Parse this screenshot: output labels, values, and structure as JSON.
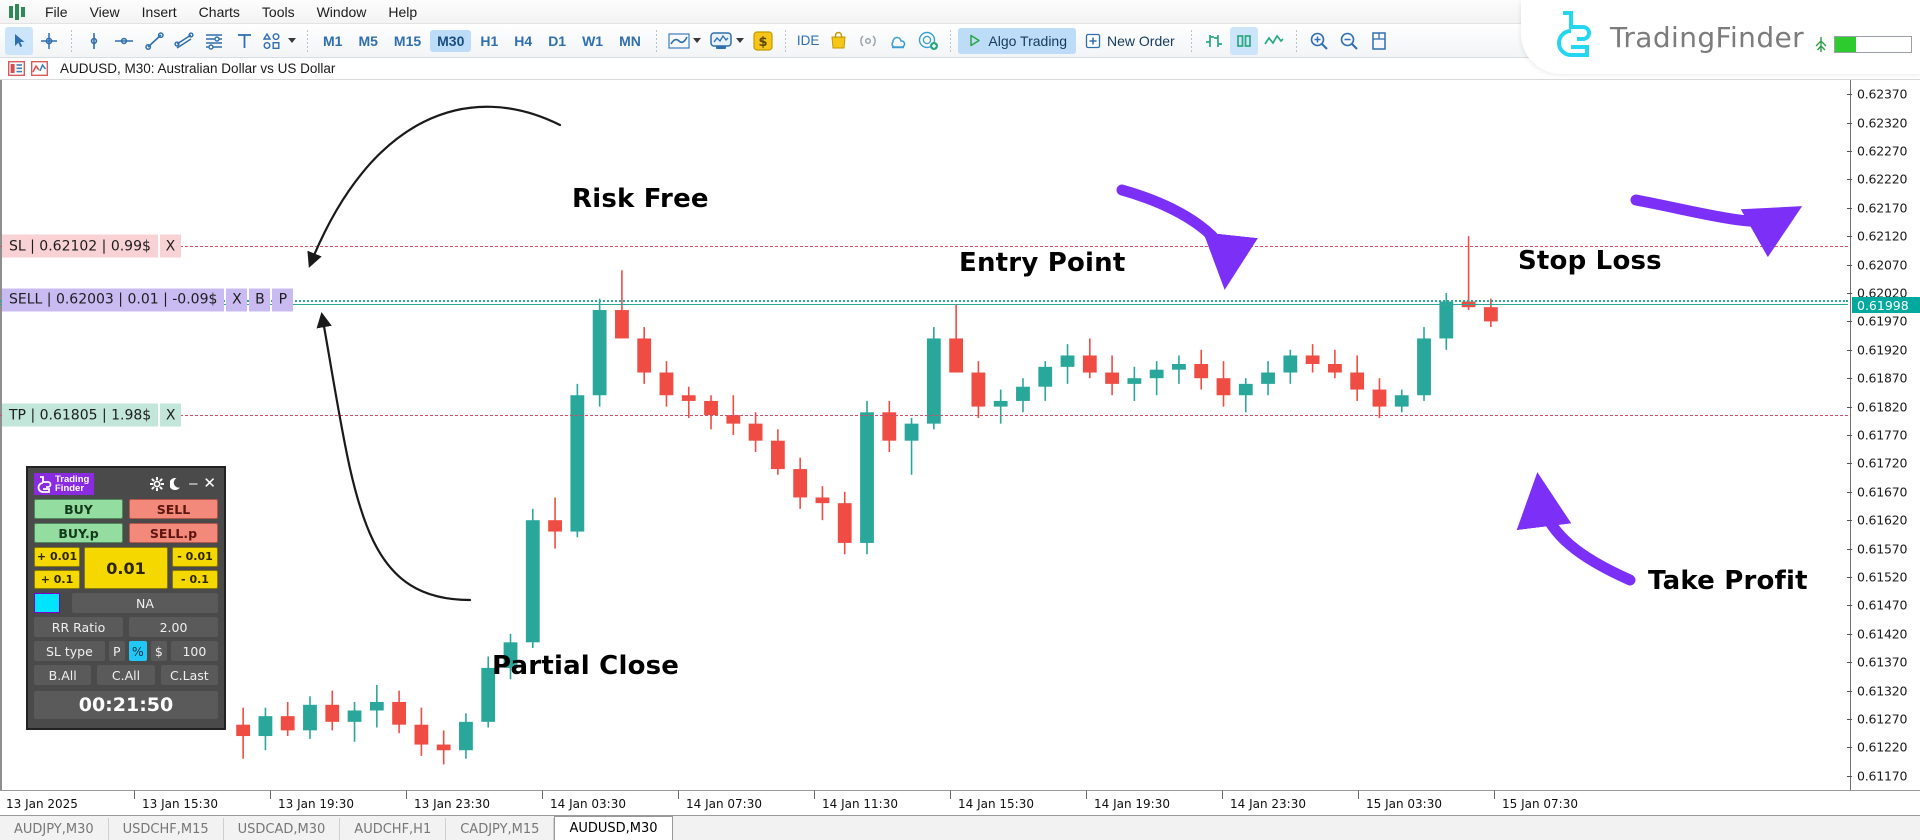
{
  "window": {
    "minimize": "–",
    "maximize": "❐",
    "close": "✕"
  },
  "menu": {
    "items": [
      "File",
      "View",
      "Insert",
      "Charts",
      "Tools",
      "Window",
      "Help"
    ]
  },
  "toolbar": {
    "tools": [
      {
        "name": "cursor-tool",
        "icon": "cursor-icon",
        "active": true
      },
      {
        "name": "crosshair-tool",
        "icon": "crosshair-icon",
        "active": false
      },
      {
        "name": "vertical-line-tool",
        "icon": "vertical-line-icon",
        "active": false
      },
      {
        "name": "horizontal-line-tool",
        "icon": "horizontal-line-icon",
        "active": false
      },
      {
        "name": "trendline-tool",
        "icon": "trendline-icon",
        "active": false
      },
      {
        "name": "channel-tool",
        "icon": "channel-icon",
        "active": false
      },
      {
        "name": "fibonacci-tool",
        "icon": "fibonacci-icon",
        "active": false
      },
      {
        "name": "text-tool",
        "icon": "text-icon",
        "active": false
      },
      {
        "name": "shapes-tool",
        "icon": "shapes-icon",
        "active": false
      }
    ],
    "timeframes": [
      "M1",
      "M5",
      "M15",
      "M30",
      "H1",
      "H4",
      "D1",
      "W1",
      "MN"
    ],
    "active_timeframe": "M30",
    "chart_types": [
      "line-chart-icon",
      "bar-chart-icon",
      "dollar-icon"
    ],
    "utilities": [
      "IDE",
      "market-bag-icon",
      "signals-icon",
      "cloud-icon",
      "vps-icon"
    ],
    "algo_trading_label": "Algo Trading",
    "algo_trading_icon": "play-icon",
    "new_order_label": "New Order",
    "new_order_icon": "plus-square-icon",
    "view_tools": [
      "bar-chart-icon-2",
      "candles-icon",
      "line-icon"
    ],
    "active_view": "candles-icon",
    "zoom_in_icon": "zoom-in-icon",
    "zoom_out_icon": "zoom-out-icon",
    "data_window_icon": "data-window-icon"
  },
  "brand": {
    "name": "TradingFinder",
    "logo_icon": "tradingfinder-logo-icon",
    "account_icon": "account-health-icon",
    "meter_percent": 28
  },
  "chart_header": {
    "properties_icon": "chart-properties-icon",
    "indicators_icon": "indicators-icon",
    "title": "AUDUSD, M30:  Australian Dollar vs US Dollar"
  },
  "colors": {
    "bull": "#2aa79b",
    "bear": "#ef4d44",
    "sl_line": "#d4536b",
    "tp_line": "#cc4f6a",
    "entry_line": "#2fa79b",
    "current_price_bg": "#00a99d",
    "annotation_arrow_purple": "#7b2ff7",
    "annotation_arrow_black": "#1a1a1a",
    "panel_bg": "#4a4a4a"
  },
  "orders": {
    "stop_loss": {
      "label": "SL | 0.62102 | 0.99$",
      "price": 0.62102,
      "amount": "0.99$",
      "close_button": "X"
    },
    "entry": {
      "label": "SELL | 0.62003 | 0.01 | -0.09$",
      "price": 0.62003,
      "volume": "0.01",
      "profit": "-0.09$",
      "buttons": [
        "X",
        "B",
        "P"
      ]
    },
    "take_profit": {
      "label": "TP | 0.61805 | 1.98$",
      "price": 0.61805,
      "amount": "1.98$",
      "close_button": "X"
    }
  },
  "annotations": [
    {
      "id": "risk-free",
      "text": "Risk Free"
    },
    {
      "id": "entry-point",
      "text": "Entry Point"
    },
    {
      "id": "stop-loss",
      "text": "Stop Loss"
    },
    {
      "id": "take-profit",
      "text": "Take Profit"
    },
    {
      "id": "partial-close",
      "text": "Partial Close"
    }
  ],
  "panel": {
    "logo_text_1": "Trading",
    "logo_text_2": "Finder",
    "logo_icon": "tradingfinder-mini-logo-icon",
    "settings_icon": "gear-icon",
    "theme_icon": "moon-icon",
    "minimize_icon": "minimize-icon",
    "close_icon": "close-icon",
    "buy": "BUY",
    "sell": "SELL",
    "buy_pending": "BUY.p",
    "sell_pending": "SELL.p",
    "lot_plus_small": "+ 0.01",
    "lot_plus_big": "+ 0.1",
    "lot_minus_small": "- 0.01",
    "lot_minus_big": "- 0.1",
    "lot_value": "0.01",
    "color_swatch": "#00e5ff",
    "na_label": "NA",
    "rr_label": "RR Ratio",
    "rr_value": "2.00",
    "sl_type_label": "SL type",
    "sl_type_options": [
      "P",
      "%",
      "$"
    ],
    "sl_type_active": "%",
    "sl_type_value": "100",
    "close_all_buy": "B.All",
    "close_all": "C.All",
    "close_last": "C.Last",
    "timer": "00:21:50"
  },
  "tabs": {
    "items": [
      "AUDJPY,M30",
      "USDCHF,M15",
      "USDCAD,M30",
      "AUDCHF,H1",
      "CADJPY,M15",
      "AUDUSD,M30"
    ],
    "active": "AUDUSD,M30"
  },
  "chart_data": {
    "type": "candlestick",
    "title": "AUDUSD, M30:  Australian Dollar vs US Dollar",
    "symbol": "AUDUSD",
    "timeframe": "M30",
    "ylabel": "",
    "xlabel": "",
    "ylim": [
      0.61145,
      0.62395
    ],
    "grid": false,
    "current_price": "0.61998",
    "price_ticks": [
      "0.62370",
      "0.62320",
      "0.62270",
      "0.62220",
      "0.62170",
      "0.62120",
      "0.62070",
      "0.62020",
      "0.61970",
      "0.61920",
      "0.61870",
      "0.61820",
      "0.61770",
      "0.61720",
      "0.61670",
      "0.61620",
      "0.61570",
      "0.61520",
      "0.61470",
      "0.61420",
      "0.61370",
      "0.61320",
      "0.61270",
      "0.61220",
      "0.61170"
    ],
    "time_ticks": [
      "13 Jan 2025",
      "13 Jan 15:30",
      "13 Jan 19:30",
      "13 Jan 23:30",
      "14 Jan 03:30",
      "14 Jan 07:30",
      "14 Jan 11:30",
      "14 Jan 15:30",
      "14 Jan 19:30",
      "14 Jan 23:30",
      "15 Jan 03:30",
      "15 Jan 07:30"
    ],
    "levels": [
      {
        "name": "stop_loss",
        "value": 0.62102,
        "color": "#d4536b",
        "style": "dashdot"
      },
      {
        "name": "entry",
        "value": 0.62003,
        "color": "#2fa79b",
        "style": "dotted"
      },
      {
        "name": "take_profit",
        "value": 0.61805,
        "color": "#cc4f6a",
        "style": "dashdot"
      }
    ],
    "candles": [
      {
        "o": 0.6126,
        "h": 0.6129,
        "l": 0.612,
        "c": 0.6124
      },
      {
        "o": 0.6124,
        "h": 0.6129,
        "l": 0.61215,
        "c": 0.61275
      },
      {
        "o": 0.61275,
        "h": 0.613,
        "l": 0.6124,
        "c": 0.6125
      },
      {
        "o": 0.6125,
        "h": 0.6131,
        "l": 0.61235,
        "c": 0.61295
      },
      {
        "o": 0.61295,
        "h": 0.6132,
        "l": 0.6125,
        "c": 0.61265
      },
      {
        "o": 0.61265,
        "h": 0.613,
        "l": 0.6123,
        "c": 0.61285
      },
      {
        "o": 0.61285,
        "h": 0.6133,
        "l": 0.61255,
        "c": 0.613
      },
      {
        "o": 0.613,
        "h": 0.6132,
        "l": 0.61245,
        "c": 0.6126
      },
      {
        "o": 0.6126,
        "h": 0.6129,
        "l": 0.61205,
        "c": 0.61225
      },
      {
        "o": 0.61225,
        "h": 0.6125,
        "l": 0.6119,
        "c": 0.61215
      },
      {
        "o": 0.61215,
        "h": 0.6128,
        "l": 0.612,
        "c": 0.61265
      },
      {
        "o": 0.61265,
        "h": 0.6138,
        "l": 0.61255,
        "c": 0.6136
      },
      {
        "o": 0.6136,
        "h": 0.6142,
        "l": 0.6134,
        "c": 0.61405
      },
      {
        "o": 0.61405,
        "h": 0.6164,
        "l": 0.61395,
        "c": 0.6162
      },
      {
        "o": 0.6162,
        "h": 0.6166,
        "l": 0.6157,
        "c": 0.616
      },
      {
        "o": 0.616,
        "h": 0.6186,
        "l": 0.6159,
        "c": 0.6184
      },
      {
        "o": 0.6184,
        "h": 0.6201,
        "l": 0.6182,
        "c": 0.6199
      },
      {
        "o": 0.6199,
        "h": 0.6206,
        "l": 0.6196,
        "c": 0.6194
      },
      {
        "o": 0.6194,
        "h": 0.6196,
        "l": 0.6186,
        "c": 0.6188
      },
      {
        "o": 0.6188,
        "h": 0.619,
        "l": 0.6182,
        "c": 0.6184
      },
      {
        "o": 0.6184,
        "h": 0.61855,
        "l": 0.618,
        "c": 0.6183
      },
      {
        "o": 0.6183,
        "h": 0.6184,
        "l": 0.6178,
        "c": 0.61805
      },
      {
        "o": 0.61805,
        "h": 0.6184,
        "l": 0.6177,
        "c": 0.6179
      },
      {
        "o": 0.6179,
        "h": 0.6181,
        "l": 0.6174,
        "c": 0.6176
      },
      {
        "o": 0.6176,
        "h": 0.6178,
        "l": 0.617,
        "c": 0.6171
      },
      {
        "o": 0.6171,
        "h": 0.6173,
        "l": 0.6164,
        "c": 0.6166
      },
      {
        "o": 0.6166,
        "h": 0.6168,
        "l": 0.6162,
        "c": 0.6165
      },
      {
        "o": 0.6165,
        "h": 0.6167,
        "l": 0.6156,
        "c": 0.6158
      },
      {
        "o": 0.6158,
        "h": 0.6183,
        "l": 0.6156,
        "c": 0.6181
      },
      {
        "o": 0.6181,
        "h": 0.6183,
        "l": 0.6174,
        "c": 0.6176
      },
      {
        "o": 0.6176,
        "h": 0.618,
        "l": 0.617,
        "c": 0.6179
      },
      {
        "o": 0.6179,
        "h": 0.6196,
        "l": 0.6178,
        "c": 0.6194
      },
      {
        "o": 0.6194,
        "h": 0.62,
        "l": 0.619,
        "c": 0.6188
      },
      {
        "o": 0.6188,
        "h": 0.619,
        "l": 0.618,
        "c": 0.6182
      },
      {
        "o": 0.6182,
        "h": 0.6185,
        "l": 0.6179,
        "c": 0.6183
      },
      {
        "o": 0.6183,
        "h": 0.6187,
        "l": 0.6181,
        "c": 0.61855
      },
      {
        "o": 0.61855,
        "h": 0.619,
        "l": 0.6183,
        "c": 0.6189
      },
      {
        "o": 0.6189,
        "h": 0.6193,
        "l": 0.6186,
        "c": 0.6191
      },
      {
        "o": 0.6191,
        "h": 0.6194,
        "l": 0.6187,
        "c": 0.6188
      },
      {
        "o": 0.6188,
        "h": 0.6191,
        "l": 0.6184,
        "c": 0.6186
      },
      {
        "o": 0.6186,
        "h": 0.6189,
        "l": 0.6183,
        "c": 0.6187
      },
      {
        "o": 0.6187,
        "h": 0.619,
        "l": 0.6184,
        "c": 0.61885
      },
      {
        "o": 0.61885,
        "h": 0.6191,
        "l": 0.6186,
        "c": 0.61895
      },
      {
        "o": 0.61895,
        "h": 0.6192,
        "l": 0.6185,
        "c": 0.6187
      },
      {
        "o": 0.6187,
        "h": 0.619,
        "l": 0.6182,
        "c": 0.6184
      },
      {
        "o": 0.6184,
        "h": 0.6187,
        "l": 0.6181,
        "c": 0.6186
      },
      {
        "o": 0.6186,
        "h": 0.619,
        "l": 0.6184,
        "c": 0.6188
      },
      {
        "o": 0.6188,
        "h": 0.6192,
        "l": 0.6186,
        "c": 0.6191
      },
      {
        "o": 0.6191,
        "h": 0.6193,
        "l": 0.6188,
        "c": 0.61895
      },
      {
        "o": 0.61895,
        "h": 0.6192,
        "l": 0.6187,
        "c": 0.6188
      },
      {
        "o": 0.6188,
        "h": 0.6191,
        "l": 0.6183,
        "c": 0.6185
      },
      {
        "o": 0.6185,
        "h": 0.6187,
        "l": 0.618,
        "c": 0.6182
      },
      {
        "o": 0.6182,
        "h": 0.6185,
        "l": 0.6181,
        "c": 0.6184
      },
      {
        "o": 0.6184,
        "h": 0.6196,
        "l": 0.6183,
        "c": 0.6194
      },
      {
        "o": 0.6194,
        "h": 0.6202,
        "l": 0.6192,
        "c": 0.62005
      },
      {
        "o": 0.62005,
        "h": 0.6212,
        "l": 0.6199,
        "c": 0.61995
      },
      {
        "o": 0.61995,
        "h": 0.6201,
        "l": 0.6196,
        "c": 0.6197
      }
    ]
  }
}
